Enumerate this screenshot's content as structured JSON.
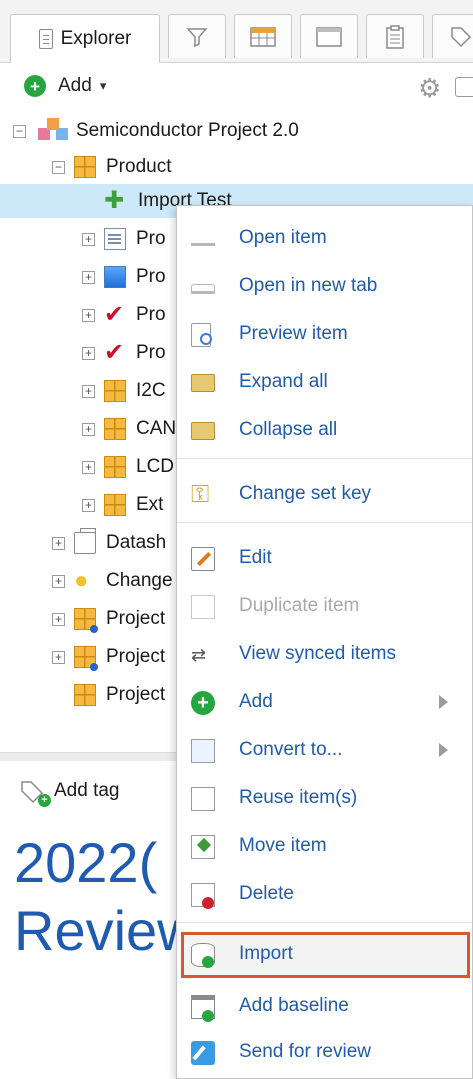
{
  "tabs": {
    "explorer_label": "Explorer"
  },
  "toolbar": {
    "add_label": "Add",
    "add_caret": "▾",
    "gear_glyph": "⚙"
  },
  "tree": {
    "root": "Semiconductor Project 2.0",
    "product": "Product",
    "selected": "Import Test",
    "child_pro_1": "Pro",
    "child_pro_2": "Pro",
    "child_pro_3": "Pro",
    "child_pro_4": "Pro",
    "child_i2c": "I2C",
    "child_can": "CAN",
    "child_lcd": "LCD",
    "child_ext": "Ext",
    "datash": "Datash",
    "change": "Change",
    "project_1": "Project",
    "project_2": "Project",
    "project_3": "Project"
  },
  "tag": {
    "add_tag_label": "Add tag"
  },
  "document": {
    "title_line1": "2022(",
    "title_line2": "Review"
  },
  "context_menu": {
    "open_item": "Open item",
    "open_in_new_tab": "Open in new tab",
    "preview_item": "Preview item",
    "expand_all": "Expand all",
    "collapse_all": "Collapse all",
    "change_set_key": "Change set key",
    "edit": "Edit",
    "duplicate_item": "Duplicate item",
    "view_synced_items": "View synced items",
    "add": "Add",
    "convert_to": "Convert to...",
    "reuse_items": "Reuse item(s)",
    "move_item": "Move item",
    "delete": "Delete",
    "import": "Import",
    "add_baseline": "Add baseline",
    "send_for_review": "Send for review"
  },
  "colors": {
    "link_blue": "#1f5bb0",
    "selection": "#cde8f8",
    "highlight_border": "#d9582b",
    "green": "#27a640"
  }
}
